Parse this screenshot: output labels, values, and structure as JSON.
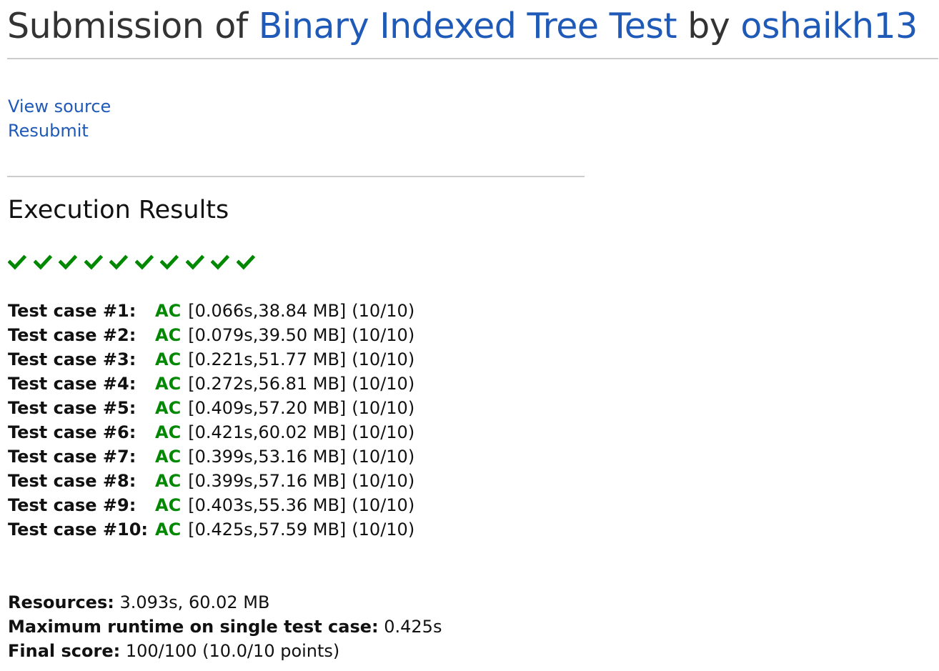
{
  "header": {
    "prefix": "Submission of ",
    "problem": "Binary Indexed Tree Test",
    "by": " by ",
    "user": "oshaikh13"
  },
  "links": {
    "view_source": "View source",
    "resubmit": "Resubmit"
  },
  "results": {
    "title": "Execution Results",
    "check_icon": "check-icon",
    "check_color": "#008800",
    "cases": [
      {
        "label": "Test case #1:",
        "status": "AC",
        "details": "[0.066s,38.84 MB]",
        "points": "(10/10)"
      },
      {
        "label": "Test case #2:",
        "status": "AC",
        "details": "[0.079s,39.50 MB]",
        "points": "(10/10)"
      },
      {
        "label": "Test case #3:",
        "status": "AC",
        "details": "[0.221s,51.77 MB]",
        "points": "(10/10)"
      },
      {
        "label": "Test case #4:",
        "status": "AC",
        "details": "[0.272s,56.81 MB]",
        "points": "(10/10)"
      },
      {
        "label": "Test case #5:",
        "status": "AC",
        "details": "[0.409s,57.20 MB]",
        "points": "(10/10)"
      },
      {
        "label": "Test case #6:",
        "status": "AC",
        "details": "[0.421s,60.02 MB]",
        "points": "(10/10)"
      },
      {
        "label": "Test case #7:",
        "status": "AC",
        "details": "[0.399s,53.16 MB]",
        "points": "(10/10)"
      },
      {
        "label": "Test case #8:",
        "status": "AC",
        "details": "[0.399s,57.16 MB]",
        "points": "(10/10)"
      },
      {
        "label": "Test case #9:",
        "status": "AC",
        "details": "[0.403s,55.36 MB]",
        "points": "(10/10)"
      },
      {
        "label": "Test case #10:",
        "status": "AC",
        "details": "[0.425s,57.59 MB]",
        "points": "(10/10)"
      }
    ]
  },
  "summary": {
    "resources_label": "Resources:",
    "resources_value": " 3.093s, 60.02 MB",
    "max_runtime_label": "Maximum runtime on single test case:",
    "max_runtime_value": " 0.425s",
    "final_score_label": "Final score:",
    "final_score_value": " 100/100 (10.0/10 points)"
  },
  "colors": {
    "link": "#1f5ab8",
    "accepted": "#008800",
    "rule": "#cccccc"
  }
}
